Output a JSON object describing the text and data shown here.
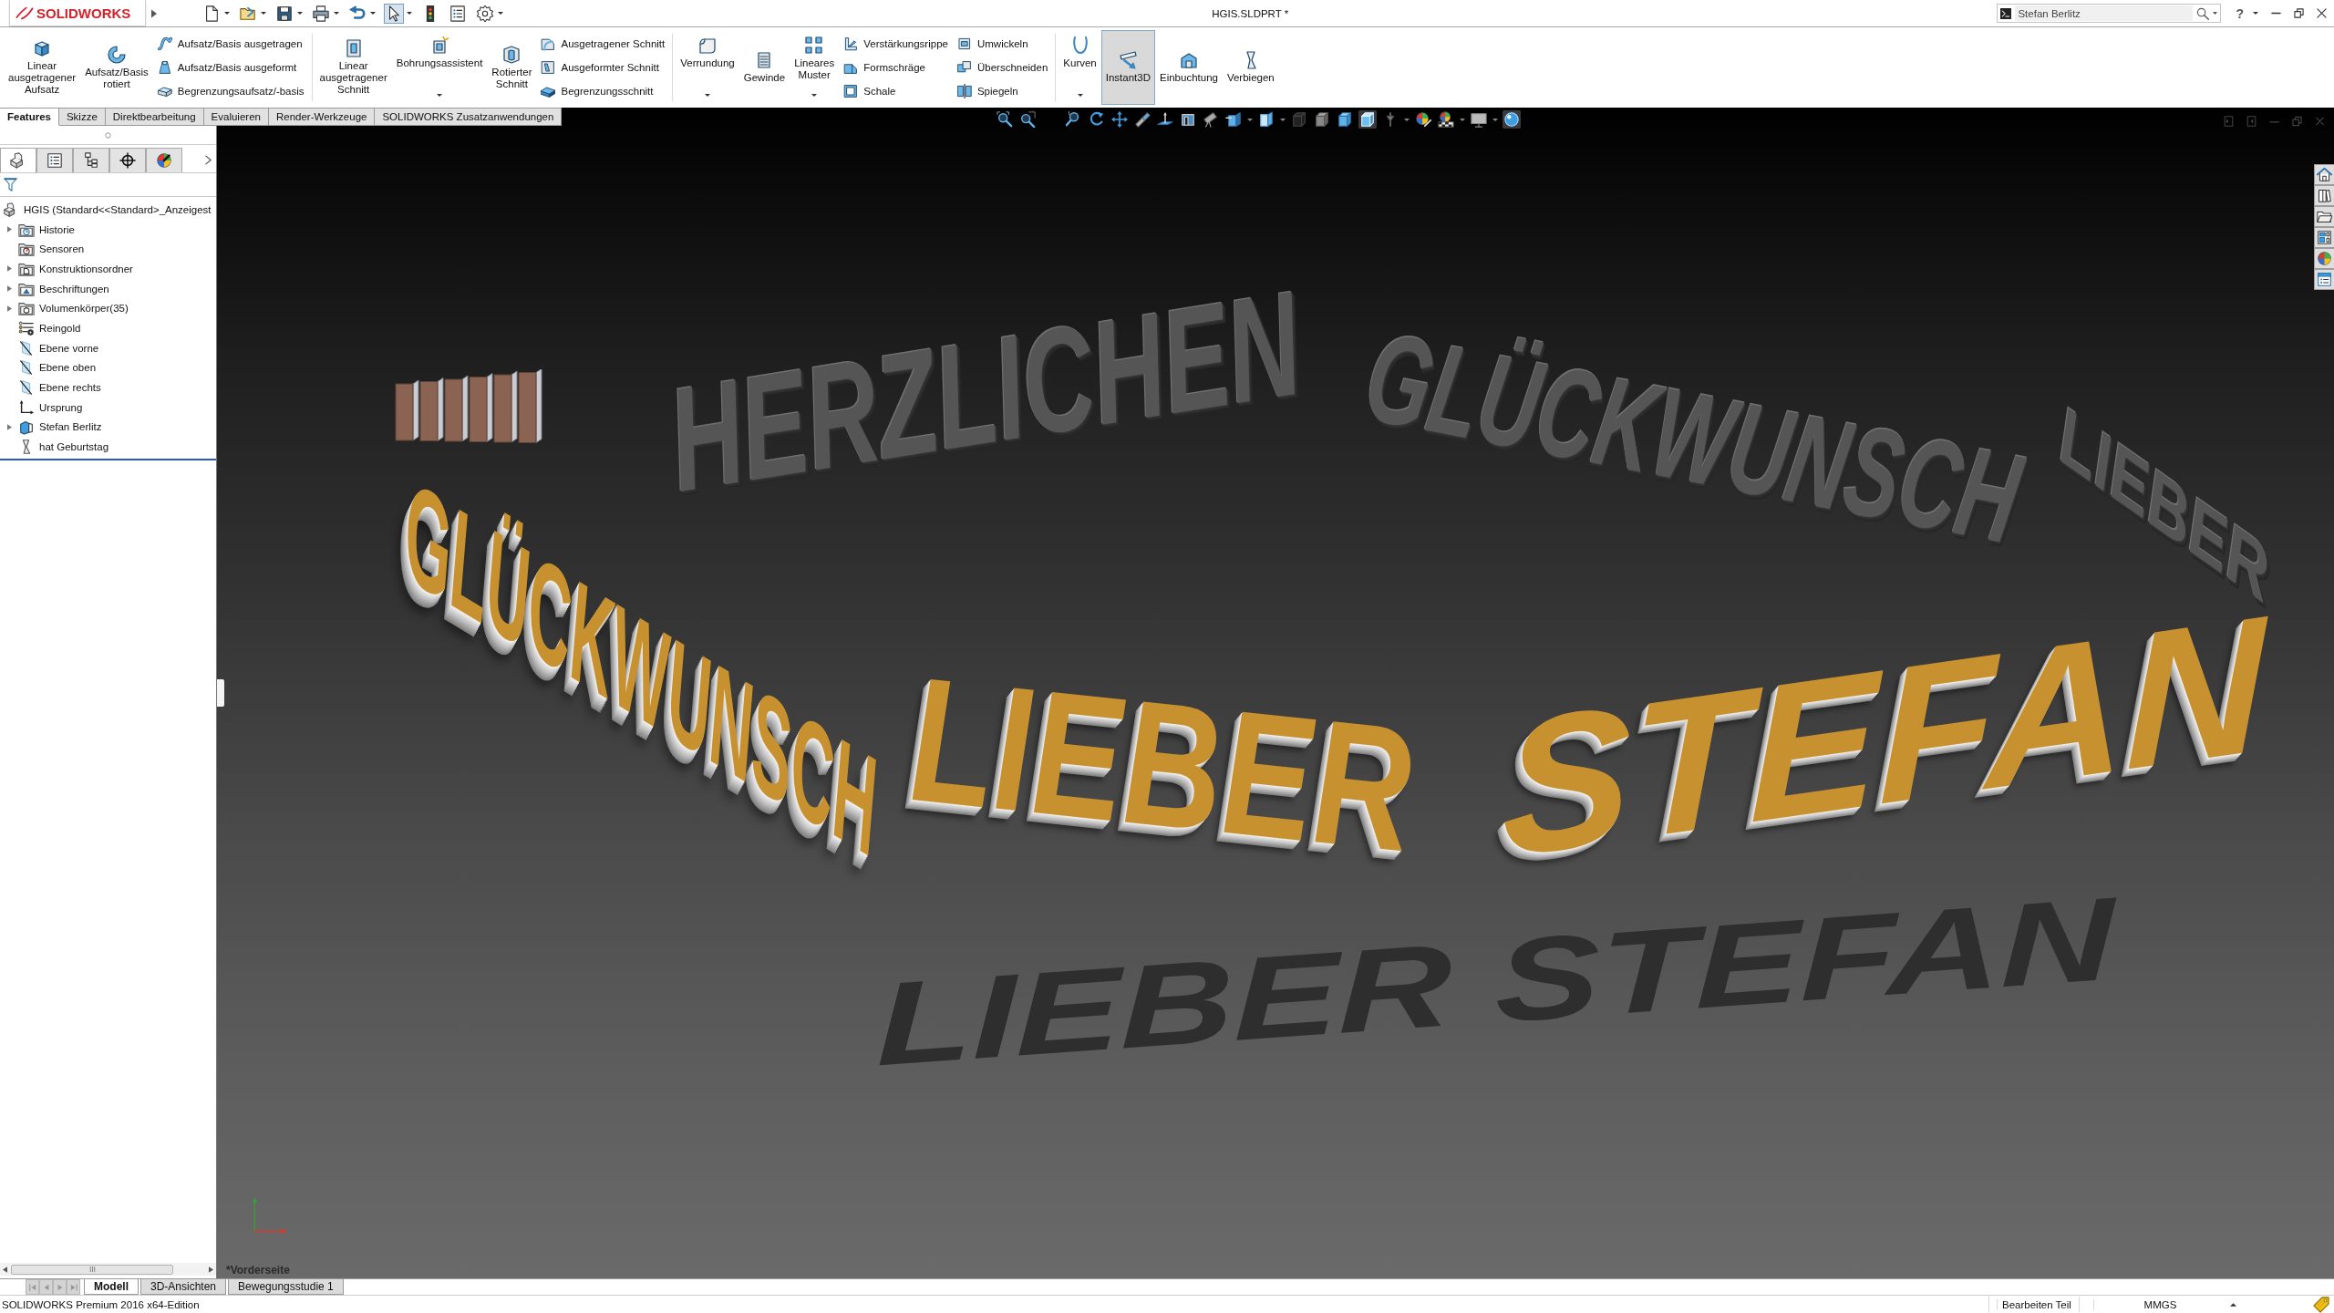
{
  "title_bar": {
    "logo": "SOLIDWORKS",
    "title": "HGIS.SLDPRT *",
    "search": {
      "value": "Stefan Berlitz"
    },
    "help": "?"
  },
  "quick_access": [
    {
      "pressed": false,
      "dropdown": true
    },
    {
      "pressed": false,
      "dropdown": true
    },
    {
      "pressed": false,
      "dropdown": true
    },
    {
      "pressed": false,
      "dropdown": true
    },
    {
      "pressed": false,
      "dropdown": true
    },
    {
      "pressed": true,
      "dropdown": true
    },
    {
      "pressed": false,
      "dropdown": false
    },
    {
      "pressed": false,
      "dropdown": false
    },
    {
      "pressed": false,
      "dropdown": true
    }
  ],
  "ribbon_groups": [
    [
      {
        "kind": "large",
        "label": "Linear\nausgetragener\nAufsatz",
        "dropdown": false,
        "pressed": false
      },
      {
        "kind": "large",
        "label": "Aufsatz/Basis\nrotiert",
        "dropdown": false,
        "pressed": false
      },
      {
        "kind": "stack",
        "items": [
          {
            "label": "Aufsatz/Basis ausgetragen"
          },
          {
            "label": "Aufsatz/Basis ausgeformt"
          },
          {
            "label": "Begrenzungsaufsatz/-basis"
          }
        ]
      }
    ],
    [
      {
        "kind": "large",
        "label": "Linear\nausgetragener\nSchnitt",
        "dropdown": false,
        "pressed": false
      },
      {
        "kind": "large",
        "label": "Bohrungsassistent",
        "dropdown": true,
        "pressed": false
      },
      {
        "kind": "large",
        "label": "Rotierter\nSchnitt",
        "dropdown": false,
        "pressed": false
      },
      {
        "kind": "stack",
        "items": [
          {
            "label": "Ausgetragener Schnitt"
          },
          {
            "label": "Ausgeformter Schnitt"
          },
          {
            "label": "Begrenzungsschnitt"
          }
        ]
      }
    ],
    [
      {
        "kind": "large",
        "label": "Verrundung",
        "dropdown": true,
        "pressed": false
      },
      {
        "kind": "large",
        "label": "Gewinde",
        "dropdown": false,
        "pressed": false
      },
      {
        "kind": "large",
        "label": "Lineares\nMuster",
        "dropdown": true,
        "pressed": false
      },
      {
        "kind": "stack",
        "items": [
          {
            "label": "Verstärkungsrippe"
          },
          {
            "label": "Formschräge"
          },
          {
            "label": "Schale"
          }
        ]
      },
      {
        "kind": "stack",
        "items": [
          {
            "label": "Umwickeln"
          },
          {
            "label": "Überschneiden"
          },
          {
            "label": "Spiegeln"
          }
        ]
      }
    ],
    [
      {
        "kind": "large",
        "label": "Kurven",
        "dropdown": true,
        "pressed": false
      },
      {
        "kind": "large",
        "label": "Instant3D",
        "dropdown": false,
        "pressed": true
      },
      {
        "kind": "large",
        "label": "Einbuchtung",
        "dropdown": false,
        "pressed": false
      },
      {
        "kind": "large",
        "label": "Verbiegen",
        "dropdown": false,
        "pressed": false
      }
    ]
  ],
  "command_tabs": [
    {
      "label": "Features",
      "selected": true
    },
    {
      "label": "Skizze",
      "selected": false
    },
    {
      "label": "Direktbearbeitung",
      "selected": false
    },
    {
      "label": "Evaluieren",
      "selected": false
    },
    {
      "label": "Render-Werkzeuge",
      "selected": false
    },
    {
      "label": "SOLIDWORKS Zusatzanwendungen",
      "selected": false
    }
  ],
  "panel_tabs": [
    {
      "selected": true
    },
    {
      "selected": false
    },
    {
      "selected": false
    },
    {
      "selected": false
    },
    {
      "selected": false
    }
  ],
  "feature_tree": {
    "root": "HGIS (Standard<<Standard>_Anzeigest",
    "items": [
      {
        "label": "Historie",
        "expandable": true
      },
      {
        "label": "Sensoren",
        "expandable": false
      },
      {
        "label": "Konstruktionsordner",
        "expandable": true
      },
      {
        "label": "Beschriftungen",
        "expandable": true
      },
      {
        "label": "Volumenkörper(35)",
        "expandable": true
      },
      {
        "label": "Reingold",
        "expandable": false
      },
      {
        "label": "Ebene vorne",
        "expandable": false
      },
      {
        "label": "Ebene oben",
        "expandable": false
      },
      {
        "label": "Ebene rechts",
        "expandable": false
      },
      {
        "label": "Ursprung",
        "expandable": false
      },
      {
        "label": "Stefan Berlitz",
        "expandable": true
      },
      {
        "label": "hat Geburtstag",
        "expandable": false
      }
    ]
  },
  "view_toolbar": [
    {
      "pressed": false,
      "dropdown": false
    },
    {
      "pressed": false,
      "dropdown": false
    },
    {
      "pressed": false,
      "dropdown": false
    },
    {
      "pressed": false,
      "dropdown": false
    },
    {
      "pressed": false,
      "dropdown": false
    },
    {
      "pressed": false,
      "dropdown": false
    },
    {
      "pressed": false,
      "dropdown": false
    },
    {
      "pressed": false,
      "dropdown": false
    },
    {
      "pressed": false,
      "dropdown": false
    },
    {
      "pressed": false,
      "dropdown": true
    },
    {
      "pressed": false,
      "dropdown": true
    },
    {
      "pressed": false,
      "dropdown": false
    },
    {
      "pressed": false,
      "dropdown": false
    },
    {
      "pressed": false,
      "dropdown": false
    },
    {
      "pressed": true,
      "dropdown": false
    },
    {
      "pressed": false,
      "dropdown": true
    },
    {
      "pressed": false,
      "dropdown": false
    },
    {
      "pressed": false,
      "dropdown": true
    },
    {
      "pressed": false,
      "dropdown": true
    },
    {
      "pressed": true,
      "dropdown": false
    }
  ],
  "viewport": {
    "view_name": "*Vorderseite",
    "lettering": [
      {
        "kind": "back",
        "text": "HERZLICHEN"
      },
      {
        "kind": "back",
        "text": "GLÜCKWUNSCH"
      },
      {
        "kind": "back",
        "text": "LIEBER"
      },
      {
        "kind": "shadow",
        "text": "LIEBER STEFAN"
      },
      {
        "kind": "front",
        "text": "GLÜCKWUNSCH"
      },
      {
        "kind": "front",
        "text": "LIEBER"
      },
      {
        "kind": "front",
        "text": "STEFAN"
      }
    ]
  },
  "model_tabs": [
    {
      "label": "Modell",
      "selected": true
    },
    {
      "label": "3D-Ansichten",
      "selected": false
    },
    {
      "label": "Bewegungsstudie 1",
      "selected": false
    }
  ],
  "status_bar": {
    "product": "SOLIDWORKS Premium 2016 x64-Edition",
    "mode": "Bearbeiten Teil",
    "units": "MMGS"
  }
}
